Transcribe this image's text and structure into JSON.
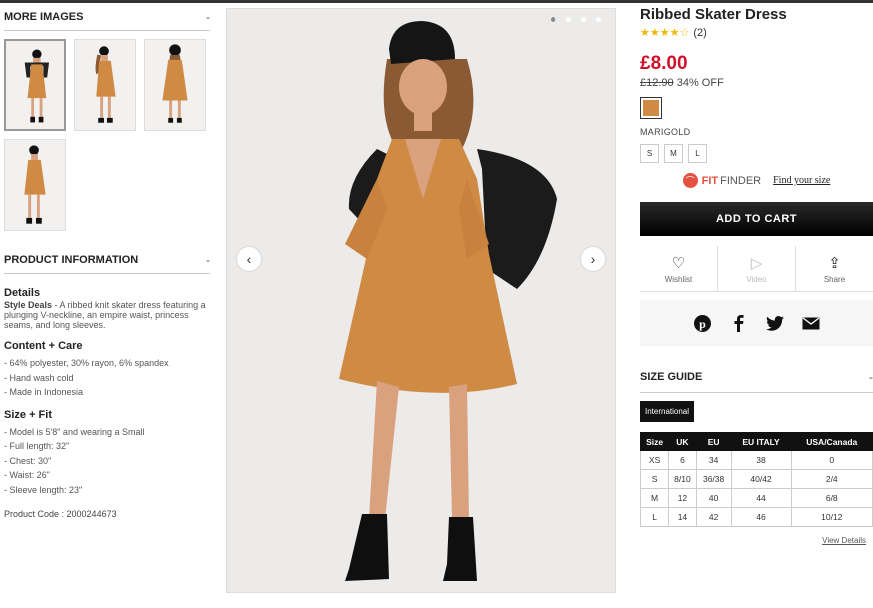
{
  "more_images": {
    "heading": "MORE IMAGES",
    "toggle": "-",
    "thumbnails": [
      "thumb-1",
      "thumb-2",
      "thumb-3",
      "thumb-4"
    ]
  },
  "product_info": {
    "heading": "PRODUCT INFORMATION",
    "toggle": "-",
    "details_heading": "Details",
    "style_deals_label": "Style Deals",
    "description": " - A ribbed knit skater dress featuring a plunging V-neckline, an empire waist, princess seams, and long sleeves.",
    "content_heading": "Content + Care",
    "content_lines": [
      "- 64% polyester, 30% rayon, 6% spandex",
      "- Hand wash cold",
      "- Made in Indonesia"
    ],
    "size_fit_heading": "Size + Fit",
    "size_fit_lines": [
      "- Model is 5'8\" and wearing a Small",
      "- Full length: 32\"",
      "- Chest: 30\"",
      "- Waist: 26\"",
      "- Sleeve length: 23\""
    ],
    "product_code": "Product Code : 2000244673"
  },
  "gallery": {
    "prev": "‹",
    "next": "›",
    "dots": 4,
    "active_dot": 1
  },
  "product": {
    "title": "Ribbed Skater Dress",
    "stars": "★★★★☆",
    "rating_value": 4,
    "review_count": "(2)",
    "price": "£8.00",
    "old_price": "£12.90",
    "discount": "34% OFF",
    "swatch_color": "#cf8a44",
    "color_name": "MARIGOLD",
    "sizes": [
      "S",
      "M",
      "L"
    ],
    "fit_brand_a": "FIT",
    "fit_brand_b": "FINDER",
    "fit_link": "Find your size",
    "add_to_cart": "ADD TO CART",
    "wishlist": "Wishlist",
    "video": "Video",
    "share": "Share"
  },
  "size_guide": {
    "heading": "SIZE GUIDE",
    "toggle": "-",
    "tab": "International",
    "columns": [
      "Size",
      "UK",
      "EU",
      "EU ITALY",
      "USA/Canada"
    ],
    "rows": [
      [
        "XS",
        "6",
        "34",
        "38",
        "0"
      ],
      [
        "S",
        "8/10",
        "36/38",
        "40/42",
        "2/4"
      ],
      [
        "M",
        "12",
        "40",
        "44",
        "6/8"
      ],
      [
        "L",
        "14",
        "42",
        "46",
        "10/12"
      ]
    ],
    "view_details": "View Details"
  },
  "colors": {
    "price_red": "#d0112b",
    "dress": "#cf8a44",
    "fit_red": "#e5513f"
  }
}
